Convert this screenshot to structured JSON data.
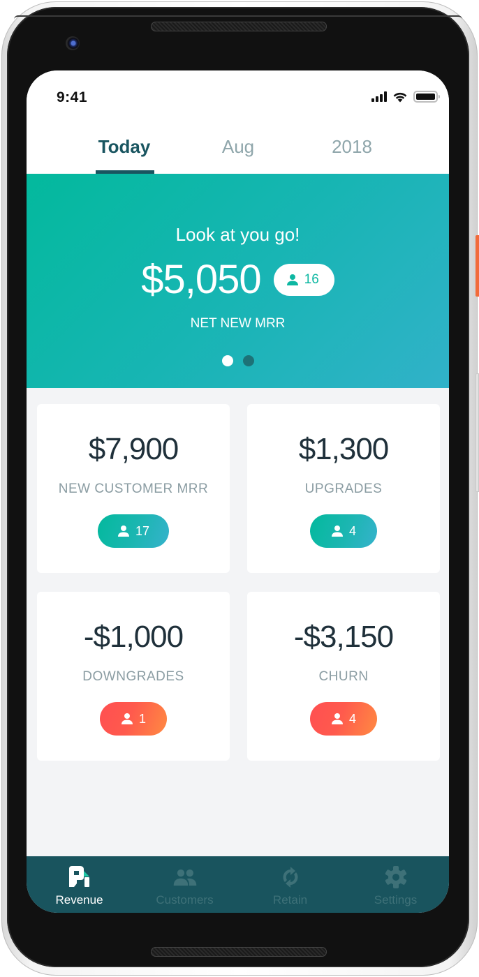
{
  "status_bar": {
    "time": "9:41",
    "icons": [
      "signal-icon",
      "wifi-icon",
      "battery-icon"
    ]
  },
  "tabs": [
    {
      "label": "Today",
      "active": true
    },
    {
      "label": "Aug",
      "active": false
    },
    {
      "label": "2018",
      "active": false
    }
  ],
  "hero": {
    "tagline": "Look at you go!",
    "amount": "$5,050",
    "customer_count": "16",
    "label": "NET NEW MRR",
    "pager": {
      "pages": 2,
      "current": 1
    }
  },
  "cards": [
    {
      "amount": "$7,900",
      "label": "NEW CUSTOMER MRR",
      "customer_count": "17",
      "tone": "positive"
    },
    {
      "amount": "$1,300",
      "label": "UPGRADES",
      "customer_count": "4",
      "tone": "positive"
    },
    {
      "amount": "-$1,000",
      "label": "DOWNGRADES",
      "customer_count": "1",
      "tone": "negative"
    },
    {
      "amount": "-$3,150",
      "label": "CHURN",
      "customer_count": "4",
      "tone": "negative"
    }
  ],
  "bottom_nav": [
    {
      "label": "Revenue",
      "icon": "revenue-logo-icon",
      "active": true
    },
    {
      "label": "Customers",
      "icon": "customers-icon",
      "active": false
    },
    {
      "label": "Retain",
      "icon": "refresh-icon",
      "active": false
    },
    {
      "label": "Settings",
      "icon": "gear-icon",
      "active": false
    }
  ],
  "colors": {
    "brand_dark": "#19545e",
    "accent_teal": "#03b99d",
    "accent_blue": "#31b2c9",
    "negative_red": "#ff4f51",
    "negative_orange": "#ff8a42",
    "amount_text": "#1f303a",
    "label_text": "#8a9ca2",
    "background": "#f3f4f6"
  }
}
